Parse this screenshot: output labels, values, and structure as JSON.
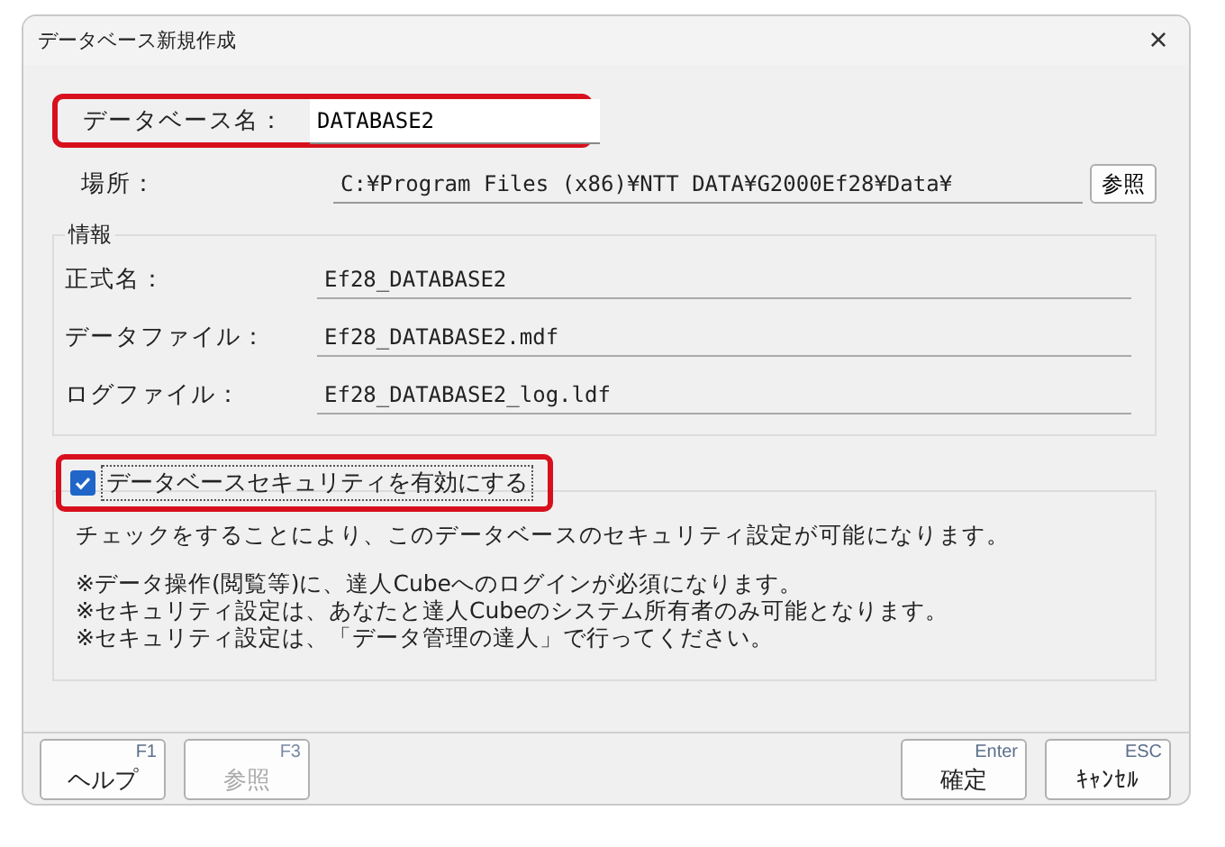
{
  "window": {
    "title": "データベース新規作成",
    "close": "×"
  },
  "name_field": {
    "label": "データベース名：",
    "value": "DATABASE2",
    "highlighted": true
  },
  "location": {
    "label": "場所：",
    "value": "C:¥Program Files (x86)¥NTT DATA¥G2000Ef28¥Data¥",
    "button": "参照"
  },
  "info": {
    "title": "情報",
    "rows": [
      {
        "label": "正式名：",
        "value": "Ef28_DATABASE2"
      },
      {
        "label": "データファイル：",
        "value": "Ef28_DATABASE2.mdf"
      },
      {
        "label": "ログファイル：",
        "value": "Ef28_DATABASE2_log.ldf"
      }
    ]
  },
  "security": {
    "label": "データベースセキュリティを有効にする",
    "checked": true,
    "highlighted": true,
    "description": "チェックをすることにより、このデータベースのセキュリティ設定が可能になります。",
    "notes": [
      "※データ操作(閲覧等)に、達人Cubeへのログインが必須になります。",
      "※セキュリティ設定は、あなたと達人Cubeのシステム所有者のみ可能となります。",
      "※セキュリティ設定は、「データ管理の達人」で行ってください。"
    ]
  },
  "buttons_left": [
    {
      "key": "F1",
      "label": "ヘルプ",
      "disabled": false
    },
    {
      "key": "F3",
      "label": "参照",
      "disabled": true
    }
  ],
  "buttons_right": [
    {
      "key": "Enter",
      "label": "確定",
      "disabled": false
    },
    {
      "key": "ESC",
      "label": "ｷｬﾝｾﾙ",
      "disabled": false
    }
  ]
}
